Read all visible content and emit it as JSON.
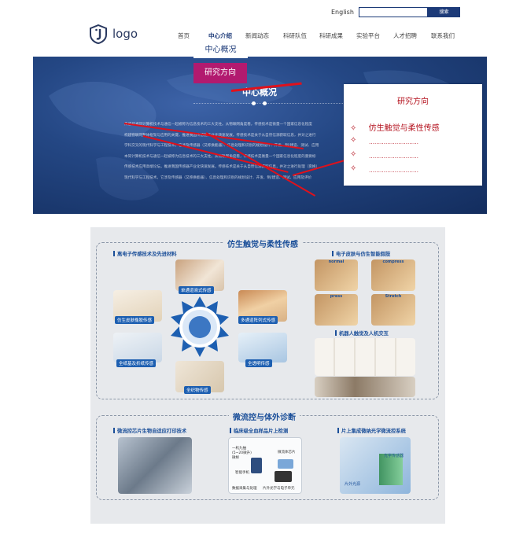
{
  "header": {
    "language": "English",
    "search": {
      "placeholder": "",
      "button_label": "搜索"
    },
    "logo_text": "logo"
  },
  "nav": {
    "items": [
      "首页",
      "中心介绍",
      "新闻动态",
      "科研队伍",
      "科研成果",
      "实验平台",
      "人才招聘",
      "联系我们"
    ],
    "active": "中心介绍",
    "dropdown": [
      "中心概况",
      "研究方向"
    ]
  },
  "hero": {
    "title": "中心概况",
    "body_lines": [
      "传感技术同计算机技术与通信一起被称为信息技术的三大支柱。从物联网角度看，传感技术是衡量一个国家信息化程度",
      "构建物联网整体框架与应用的关键，推进我国传感器产业化快速发展。传感技术是关于从自然信源获取信息，并对之进行",
      "学科交叉的现代科学与工程技术。它涉及传感器（又称换能器）、信息处理和识别的规划设计、开发、制/建造、测试、应用",
      "本同计算机技术与通信一起被称为信息技术的三大支柱。从物联网角度看，传感技术是衡量一个国家信息化程度的重要标",
      "传感技术应用高端论坛，推进我国传感器产业化快速发展。传感技术是关于从自然信源获取信息，并对之进行处理（变换）",
      "现代科学与工程技术。它涉及传感器（又称换能器）、信息处理和识别的规划设计、开发、制/建造、测试、应用及评价"
    ]
  },
  "card": {
    "title": "研究方向",
    "items": [
      {
        "bullet": "✧",
        "text": "仿生触觉与柔性传感"
      },
      {
        "bullet": "✧",
        "text": "………………………"
      },
      {
        "bullet": "✧",
        "text": "………………………"
      },
      {
        "bullet": "✧",
        "text": "………………………"
      }
    ]
  },
  "poster": {
    "section1": {
      "title": "仿生触觉与柔性传感",
      "left_heading": "离电子传感技术及先进材料",
      "right_heading": "电子皮肤与仿生智能假肢",
      "hub_labels": [
        "单通道液式传感",
        "仿生皮肤橡胶传感",
        "多通道阵列式传感",
        "全纸基及折纸传感",
        "全透明传感",
        "全织物传感"
      ],
      "skin_panels": [
        "normal",
        "compress",
        "press",
        "Stretch"
      ],
      "robot_heading": "机器人触觉及人机交互"
    },
    "section2": {
      "title": "微流控与体外诊断",
      "headings": [
        "微流控芯片生物自适应打印技术",
        "临床级全血样品片上检测",
        "片上集成微纳光学微流控系统"
      ],
      "diagram_labels": [
        "一机九抽\n(5~20微升)\n微样",
        "微流体芯片",
        "智能手机",
        "片外光学与电子单元",
        "数据采集与处理"
      ],
      "optics_labels": [
        "光学传感器",
        "片外光源"
      ]
    }
  },
  "colors": {
    "navy": "#1c3a78",
    "magenta": "#b21a6f",
    "red": "#b4121e",
    "poster_blue": "#1b4f99",
    "label_blue": "#1d5fb1"
  }
}
